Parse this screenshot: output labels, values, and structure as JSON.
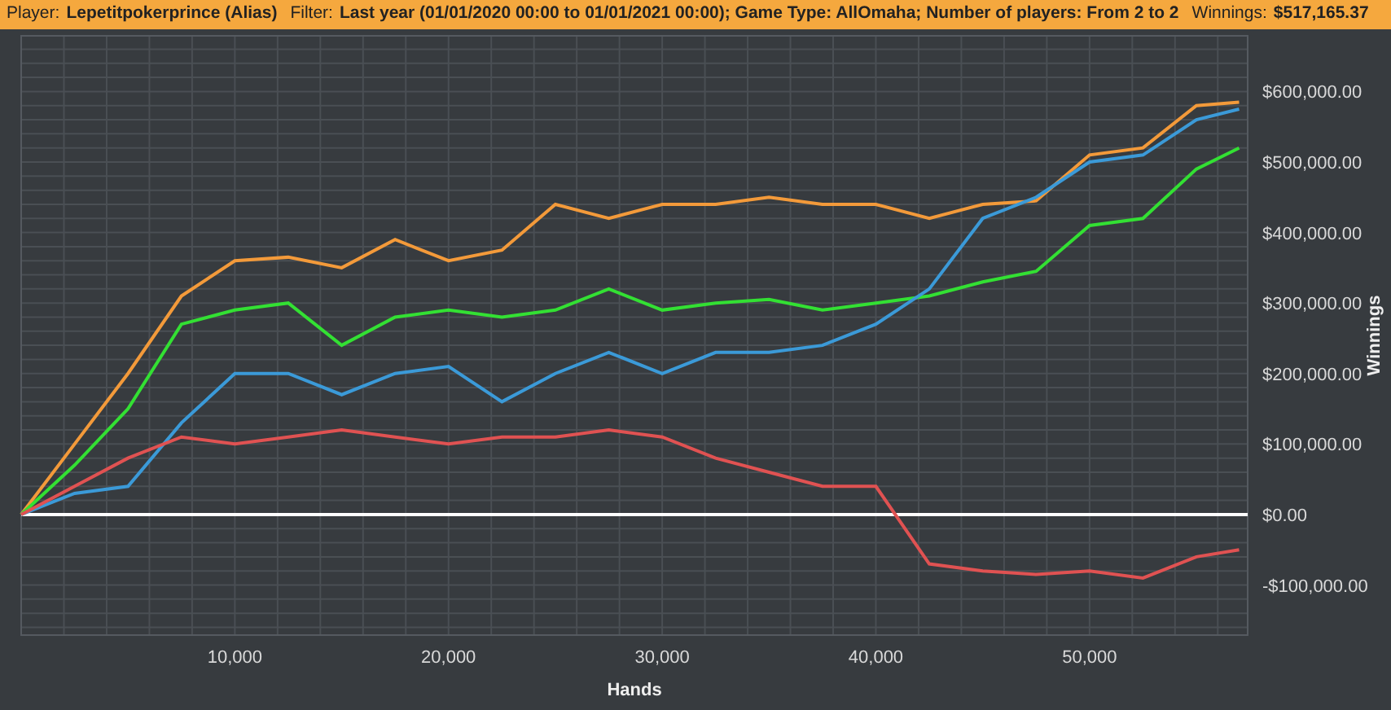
{
  "header": {
    "fields": [
      {
        "label": "Player:",
        "value": "Lepetitpokerprince (Alias)"
      },
      {
        "label": "Filter:",
        "value": "Last year (01/01/2020 00:00 to 01/01/2021 00:00); Game Type: AllOmaha; Number of players: From 2 to 2"
      },
      {
        "label": "Winnings:",
        "value": "$517,165.37"
      }
    ]
  },
  "chart": {
    "chart_data": {
      "type": "line",
      "xlabel": "Hands",
      "ylabel": "Winnings",
      "x": [
        0,
        2500,
        5000,
        7500,
        10000,
        12500,
        15000,
        17500,
        20000,
        22500,
        25000,
        27500,
        30000,
        32500,
        35000,
        37500,
        40000,
        42500,
        45000,
        47500,
        50000,
        52500,
        55000,
        57000
      ],
      "series": [
        {
          "color": "#f39a3a",
          "values": [
            0,
            100000,
            200000,
            310000,
            360000,
            365000,
            350000,
            390000,
            360000,
            375000,
            440000,
            420000,
            440000,
            440000,
            450000,
            440000,
            440000,
            420000,
            440000,
            445000,
            510000,
            520000,
            580000,
            585000
          ]
        },
        {
          "color": "#33e033",
          "values": [
            0,
            70000,
            150000,
            270000,
            290000,
            300000,
            240000,
            280000,
            290000,
            280000,
            290000,
            320000,
            290000,
            300000,
            305000,
            290000,
            300000,
            310000,
            330000,
            345000,
            410000,
            420000,
            490000,
            520000
          ]
        },
        {
          "color": "#3b9ad8",
          "values": [
            0,
            30000,
            40000,
            130000,
            200000,
            200000,
            170000,
            200000,
            210000,
            160000,
            200000,
            230000,
            200000,
            230000,
            230000,
            240000,
            270000,
            320000,
            420000,
            450000,
            500000,
            510000,
            560000,
            575000
          ]
        },
        {
          "color": "#e05252",
          "values": [
            0,
            40000,
            80000,
            110000,
            100000,
            110000,
            120000,
            110000,
            100000,
            110000,
            110000,
            120000,
            110000,
            80000,
            60000,
            40000,
            40000,
            -70000,
            -80000,
            -85000,
            -80000,
            -90000,
            -60000,
            -50000
          ]
        }
      ],
      "grid": true,
      "xlim": [
        0,
        57400
      ],
      "ylim": [
        -171000,
        679000
      ],
      "xticks": [
        {
          "value": 10000,
          "label": "10,000"
        },
        {
          "value": 20000,
          "label": "20,000"
        },
        {
          "value": 30000,
          "label": "30,000"
        },
        {
          "value": 40000,
          "label": "40,000"
        },
        {
          "value": 50000,
          "label": "50,000"
        }
      ],
      "yticks": [
        {
          "value": -100000,
          "label": "-$100,000.00"
        },
        {
          "value": 0,
          "label": "$0.00"
        },
        {
          "value": 100000,
          "label": "$100,000.00"
        },
        {
          "value": 200000,
          "label": "$200,000.00"
        },
        {
          "value": 300000,
          "label": "$300,000.00"
        },
        {
          "value": 400000,
          "label": "$400,000.00"
        },
        {
          "value": 500000,
          "label": "$500,000.00"
        },
        {
          "value": 600000,
          "label": "$600,000.00"
        }
      ]
    }
  }
}
